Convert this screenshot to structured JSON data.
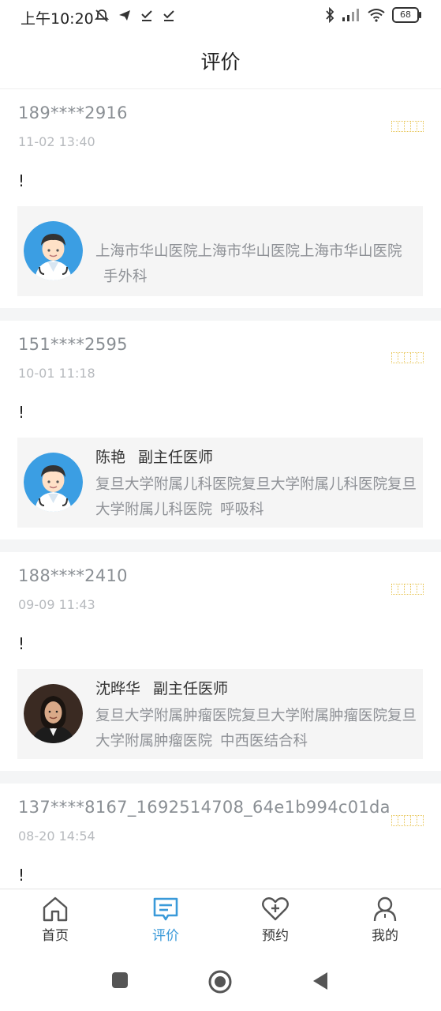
{
  "status_bar": {
    "time": "上午10:20",
    "battery": "68"
  },
  "header": {
    "title": "评价"
  },
  "reviews": [
    {
      "user": "189****2916",
      "date": "11-02 13:40",
      "comment": "!",
      "doctor_name": "",
      "doctor_title": "",
      "hospital": "上海市华山医院上海市华山医院上海市华山医院",
      "department": "手外科"
    },
    {
      "user": "151****2595",
      "date": "10-01 11:18",
      "comment": "!",
      "doctor_name": "陈艳",
      "doctor_title": "副主任医师",
      "hospital": "复旦大学附属儿科医院复旦大学附属儿科医院复旦大学附属儿科医院",
      "department": "呼吸科"
    },
    {
      "user": "188****2410",
      "date": "09-09 11:43",
      "comment": "!",
      "doctor_name": "沈晔华",
      "doctor_title": "副主任医师",
      "hospital": "复旦大学附属肿瘤医院复旦大学附属肿瘤医院复旦大学附属肿瘤医院",
      "department": "中西医结合科"
    },
    {
      "user": "137****8167_1692514708_64e1b994c01da",
      "date": "08-20 14:54",
      "comment": "!"
    }
  ],
  "bottom_nav": {
    "items": [
      {
        "label": "首页",
        "icon": "home-icon"
      },
      {
        "label": "评价",
        "icon": "review-icon",
        "active": true
      },
      {
        "label": "预约",
        "icon": "heart-plus-icon"
      },
      {
        "label": "我的",
        "icon": "person-icon"
      }
    ]
  },
  "colors": {
    "accent": "#3a9ad9",
    "star": "#e7c453"
  }
}
